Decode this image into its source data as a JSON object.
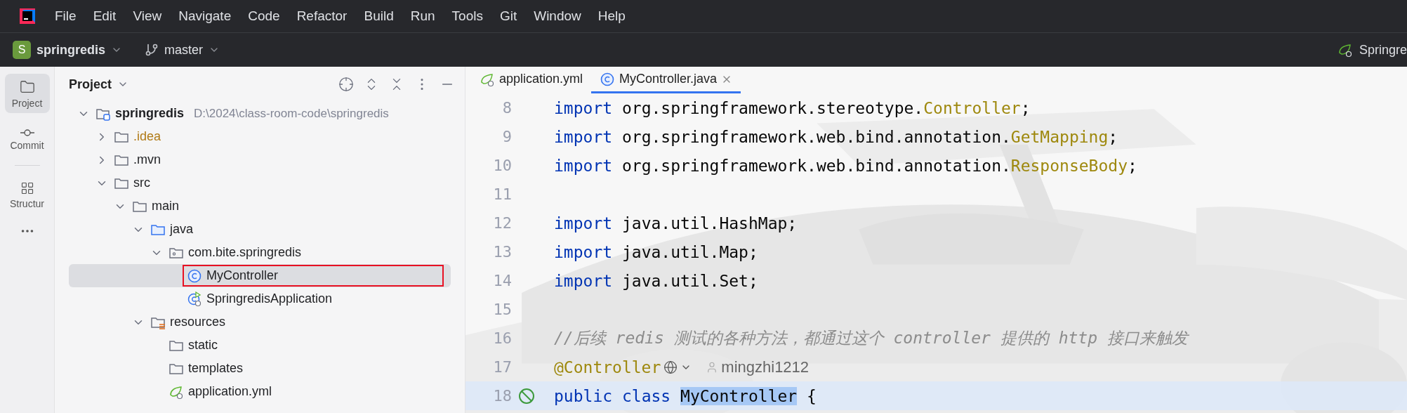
{
  "menu": [
    "File",
    "Edit",
    "View",
    "Navigate",
    "Code",
    "Refactor",
    "Build",
    "Run",
    "Tools",
    "Git",
    "Window",
    "Help"
  ],
  "toolbar": {
    "project": {
      "badge": "S",
      "name": "springredis"
    },
    "branch": "master",
    "run_config": "Springre"
  },
  "tool_strip": [
    {
      "label": "Project",
      "selected": true
    },
    {
      "label": "Commit",
      "selected": false
    },
    {
      "label": "Structur",
      "selected": false
    }
  ],
  "project_panel": {
    "title": "Project",
    "tree": [
      {
        "name": "springredis",
        "kind": "module",
        "path": "D:\\2024\\class-room-code\\springredis",
        "expanded": true,
        "selected": false,
        "children": [
          {
            "name": ".idea",
            "kind": "folder",
            "color": "#b07a16",
            "expanded": false,
            "selected": false
          },
          {
            "name": ".mvn",
            "kind": "folder",
            "expanded": false,
            "selected": false
          },
          {
            "name": "src",
            "kind": "folder",
            "expanded": true,
            "selected": false,
            "children": [
              {
                "name": "main",
                "kind": "folder",
                "expanded": true,
                "selected": false,
                "children": [
                  {
                    "name": "java",
                    "kind": "source",
                    "expanded": true,
                    "selected": false,
                    "children": [
                      {
                        "name": "com.bite.springredis",
                        "kind": "package",
                        "expanded": true,
                        "selected": false,
                        "children": [
                          {
                            "name": "MyController",
                            "kind": "class",
                            "selected": true,
                            "annotated": true
                          },
                          {
                            "name": "SpringredisApplication",
                            "kind": "spring_app",
                            "selected": false
                          }
                        ]
                      }
                    ]
                  },
                  {
                    "name": "resources",
                    "kind": "resources",
                    "expanded": true,
                    "selected": false,
                    "children": [
                      {
                        "name": "static",
                        "kind": "folder",
                        "selected": false
                      },
                      {
                        "name": "templates",
                        "kind": "folder",
                        "selected": false
                      },
                      {
                        "name": "application.yml",
                        "kind": "yml",
                        "selected": false
                      }
                    ]
                  }
                ]
              }
            ]
          }
        ]
      }
    ]
  },
  "editor": {
    "tabs": [
      {
        "label": "application.yml",
        "kind": "yml",
        "selected": false
      },
      {
        "label": "MyController.java",
        "kind": "class",
        "selected": true,
        "closable": true
      }
    ],
    "lines": [
      {
        "number": "8",
        "tokens": [
          {
            "text": "import",
            "kind": "keyword"
          },
          {
            "text": " org.springframework.stereotype.",
            "kind": "plain"
          },
          {
            "text": "Controller",
            "kind": "annotation"
          },
          {
            "text": ";",
            "kind": "plain"
          }
        ]
      },
      {
        "number": "9",
        "tokens": [
          {
            "text": "import",
            "kind": "keyword"
          },
          {
            "text": " org.springframework.web.bind.annotation.",
            "kind": "plain"
          },
          {
            "text": "GetMapping",
            "kind": "annotation"
          },
          {
            "text": ";",
            "kind": "plain"
          }
        ]
      },
      {
        "number": "10",
        "tokens": [
          {
            "text": "import",
            "kind": "keyword"
          },
          {
            "text": " org.springframework.web.bind.annotation.",
            "kind": "plain"
          },
          {
            "text": "ResponseBody",
            "kind": "annotation"
          },
          {
            "text": ";",
            "kind": "plain"
          }
        ]
      },
      {
        "number": "11"
      },
      {
        "number": "12",
        "tokens": [
          {
            "text": "import",
            "kind": "keyword"
          },
          {
            "text": " java.util.HashMap;",
            "kind": "plain"
          }
        ]
      },
      {
        "number": "13",
        "tokens": [
          {
            "text": "import",
            "kind": "keyword"
          },
          {
            "text": " java.util.Map;",
            "kind": "plain"
          }
        ]
      },
      {
        "number": "14",
        "tokens": [
          {
            "text": "import",
            "kind": "keyword"
          },
          {
            "text": " java.util.Set;",
            "kind": "plain"
          }
        ]
      },
      {
        "number": "15"
      },
      {
        "number": "16",
        "tokens": [
          {
            "text": "//后续 redis 测试的各种方法，都通过这个 controller 提供的 http 接口来触发",
            "kind": "comment"
          }
        ]
      },
      {
        "number": "17",
        "tokens": [
          {
            "text": "@Controller",
            "kind": "annotation"
          }
        ],
        "author": "mingzhi1212"
      },
      {
        "number": "18",
        "current": true,
        "bean": true,
        "tokens": [
          {
            "text": "public",
            "kind": "keyword"
          },
          {
            "text": " class ",
            "kind": "keyword"
          },
          {
            "text": "MyController",
            "kind": "selection"
          },
          {
            "text": " {",
            "kind": "plain"
          }
        ]
      }
    ]
  }
}
